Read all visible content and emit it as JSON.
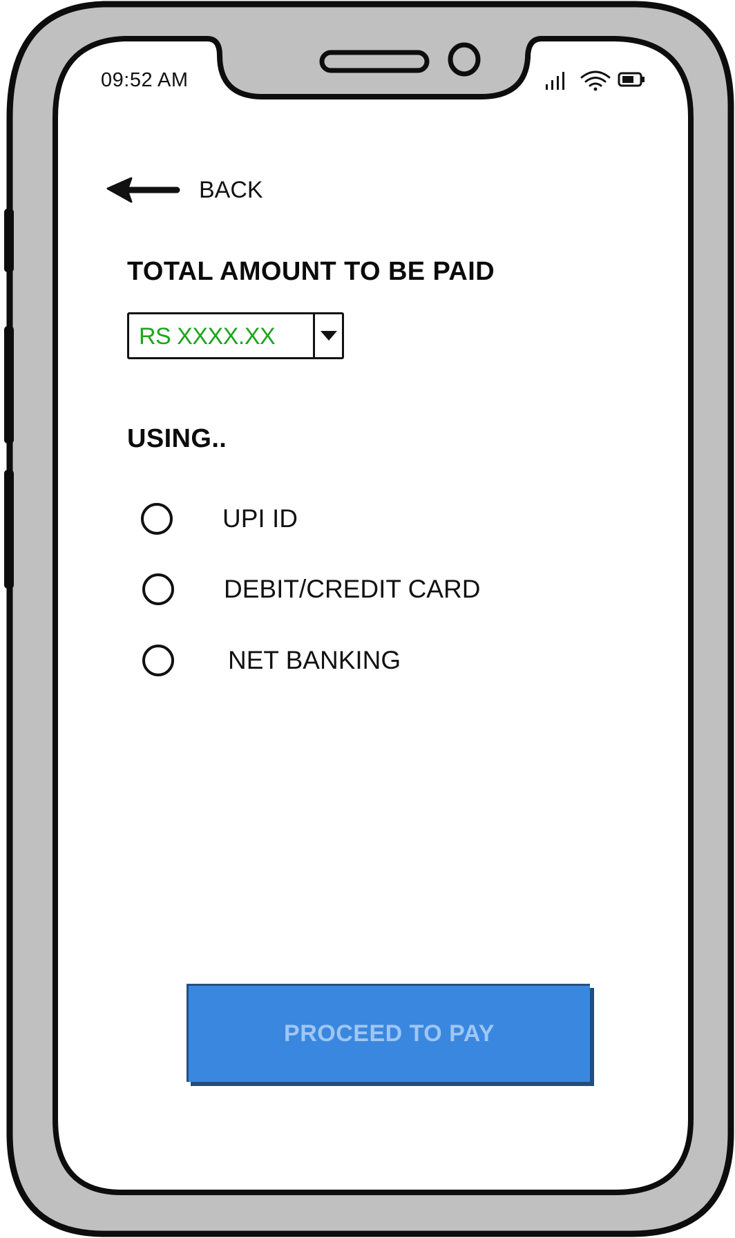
{
  "status_bar": {
    "time": "09:52 AM",
    "icons": [
      "signal-icon",
      "wifi-icon",
      "battery-icon"
    ]
  },
  "nav": {
    "back_label": "BACK",
    "back_icon": "arrow-left-icon"
  },
  "amount_section": {
    "title": "TOTAL AMOUNT TO BE PAID",
    "selected_value": "RS XXXX.XX",
    "value_color": "#1ca61c"
  },
  "payment_section": {
    "title": "USING..",
    "options": [
      {
        "label": "UPI ID",
        "selected": false
      },
      {
        "label": "DEBIT/CREDIT CARD",
        "selected": false
      },
      {
        "label": "NET BANKING",
        "selected": false
      }
    ]
  },
  "actions": {
    "proceed_label": "PROCEED TO PAY",
    "proceed_color": "#3a87e0",
    "proceed_text_color": "#9fc6f2"
  }
}
